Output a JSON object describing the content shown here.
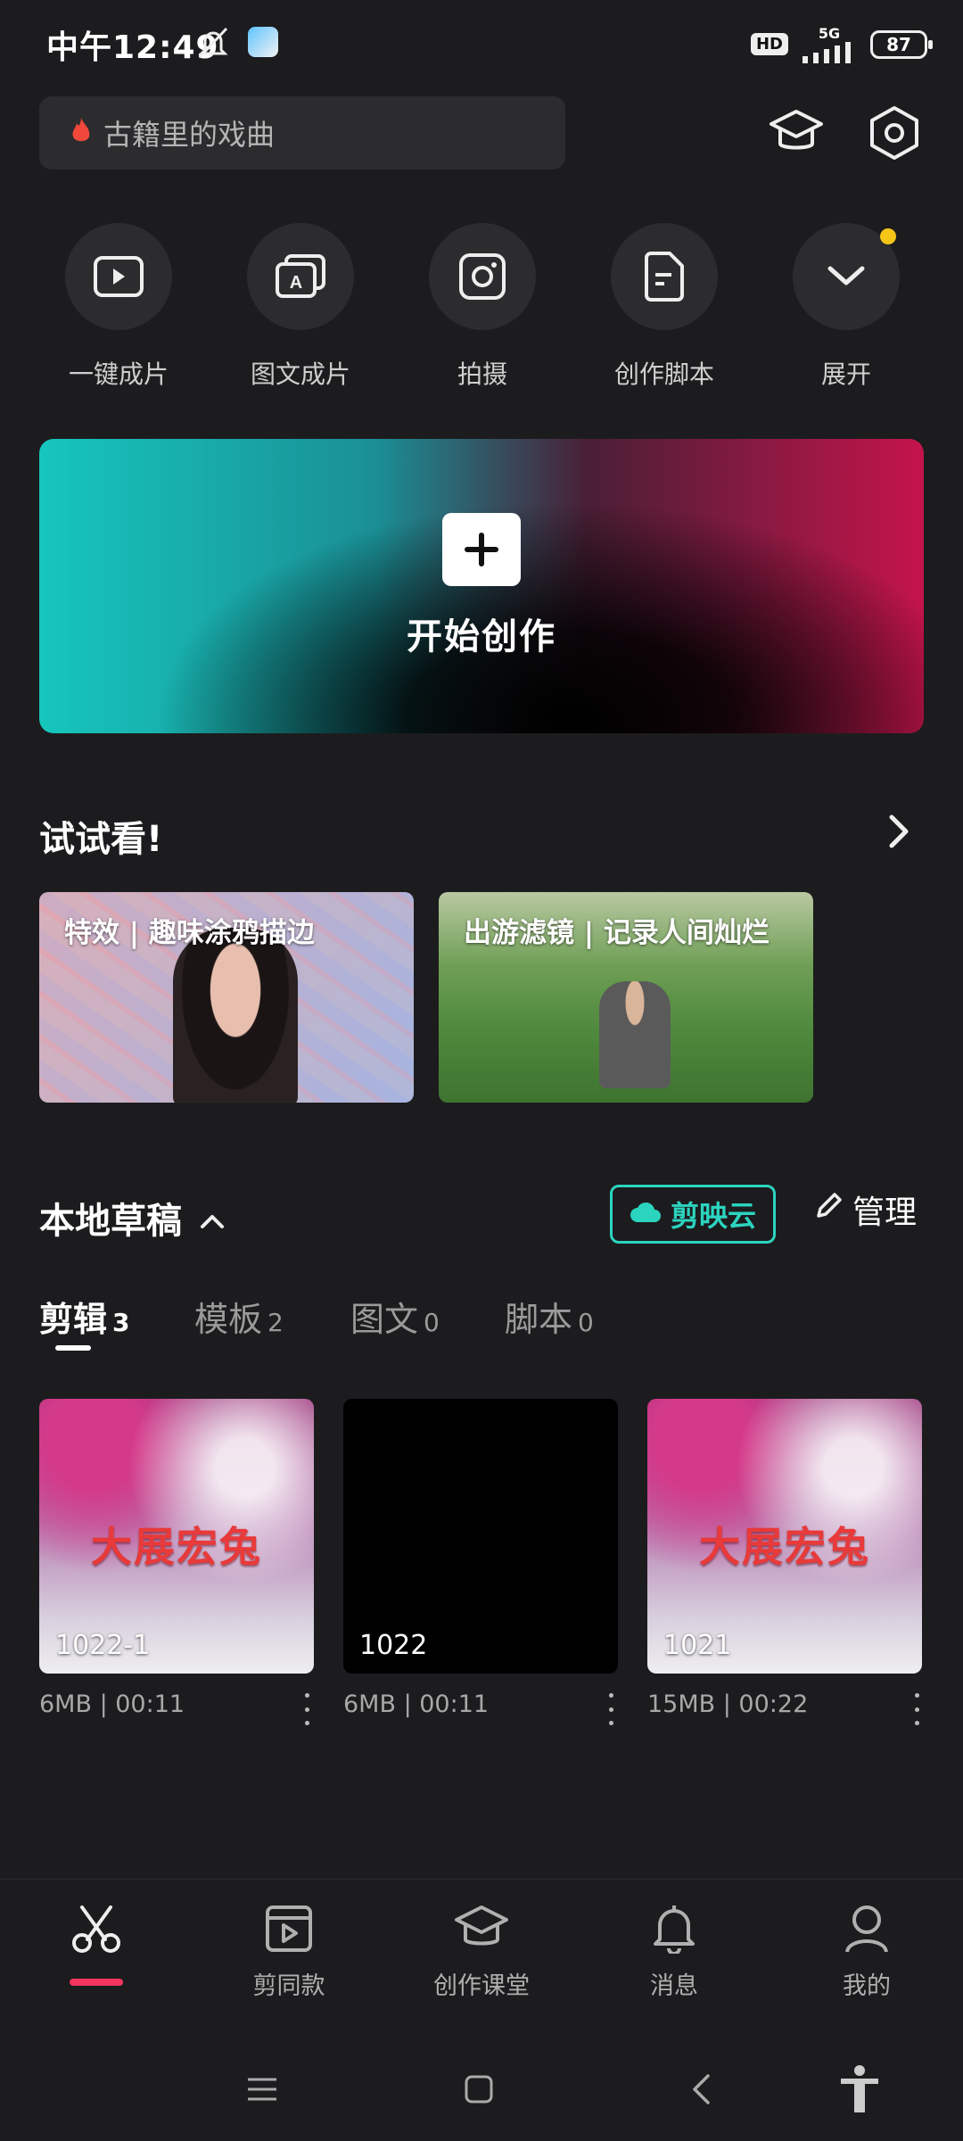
{
  "status_bar": {
    "time": "中午12:49",
    "network": "5G",
    "battery": "87",
    "hd": "HD"
  },
  "search": {
    "placeholder": "古籍里的戏曲",
    "icon": "fire-icon"
  },
  "header_actions": [
    {
      "icon": "graduation-cap-icon"
    },
    {
      "icon": "settings-hexagon-icon"
    }
  ],
  "quick_actions": [
    {
      "label": "一键成片",
      "icon": "play-square-icon"
    },
    {
      "label": "图文成片",
      "icon": "text-image-icon"
    },
    {
      "label": "拍摄",
      "icon": "camera-icon"
    },
    {
      "label": "创作脚本",
      "icon": "script-doc-icon"
    },
    {
      "label": "展开",
      "icon": "chevron-down-icon",
      "has_dot": true
    }
  ],
  "create": {
    "label": "开始创作",
    "gradient": [
      "#16c6bd",
      "#000000",
      "#c4144b"
    ]
  },
  "try_section": {
    "title": "试试看!",
    "items": [
      {
        "caption": "特效 | 趣味涂鸦描边"
      },
      {
        "caption": "出游滤镜 | 记录人间灿烂"
      }
    ]
  },
  "drafts": {
    "title": "本地草稿",
    "cloud_label": "剪映云",
    "manage_label": "管理",
    "accent": "#2bd4bf",
    "tabs": [
      {
        "label": "剪辑",
        "count": "3",
        "active": true
      },
      {
        "label": "模板",
        "count": "2"
      },
      {
        "label": "图文",
        "count": "0"
      },
      {
        "label": "脚本",
        "count": "0"
      }
    ],
    "items": [
      {
        "name": "1022-1",
        "meta": "6MB | 00:11",
        "art_text": "大展宏兔"
      },
      {
        "name": "1022",
        "meta": "6MB | 00:11"
      },
      {
        "name": "1021",
        "meta": "15MB | 00:22",
        "art_text": "大展宏兔"
      }
    ]
  },
  "bottom_nav": {
    "active_color": "#f2355d",
    "items": [
      {
        "label": "",
        "icon": "scissors-icon",
        "active": true
      },
      {
        "label": "剪同款",
        "icon": "template-clip-icon"
      },
      {
        "label": "创作课堂",
        "icon": "graduation-cap-icon"
      },
      {
        "label": "消息",
        "icon": "bell-icon"
      },
      {
        "label": "我的",
        "icon": "profile-icon"
      }
    ]
  },
  "system_nav": [
    {
      "icon": "menu-icon"
    },
    {
      "icon": "home-square-icon"
    },
    {
      "icon": "back-icon"
    },
    {
      "icon": "accessibility-icon"
    }
  ]
}
